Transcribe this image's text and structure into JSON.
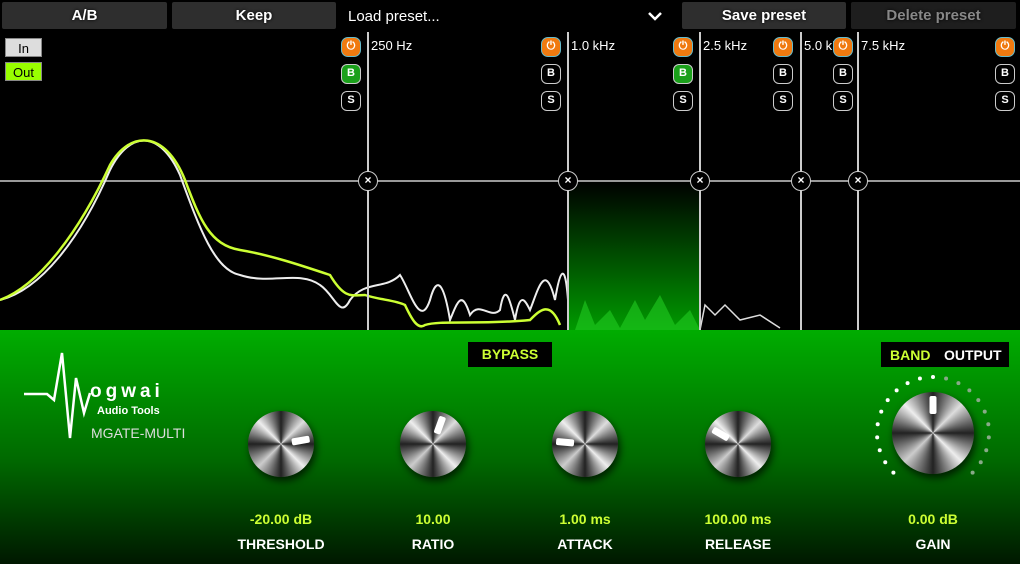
{
  "toolbar": {
    "ab": "A/B",
    "keep": "Keep",
    "load_preset": "Load preset...",
    "save_preset": "Save preset",
    "delete_preset": "Delete preset"
  },
  "io": {
    "in": "In",
    "out": "Out"
  },
  "bands": [
    {
      "freq": "250 Hz",
      "power": true,
      "b": true,
      "s": false
    },
    {
      "freq": "1.0 kHz",
      "power": true,
      "b": false,
      "s": false
    },
    {
      "freq": "2.5 kHz",
      "power": true,
      "b": true,
      "s": false
    },
    {
      "freq": "5.0 kHz",
      "power": true,
      "b": false,
      "s": false
    },
    {
      "freq": "7.5 kHz",
      "power": true,
      "b": false,
      "s": false
    },
    {
      "power": true,
      "b": false,
      "s": false
    }
  ],
  "icon_labels": {
    "b": "B",
    "s": "S",
    "x": "×",
    "power": "⏻"
  },
  "brand": {
    "logo": "ogwai",
    "sub": "Audio Tools",
    "product": "MGATE-MULTI"
  },
  "buttons": {
    "bypass": "BYPASS",
    "band": "BAND",
    "output": "OUTPUT"
  },
  "knobs": [
    {
      "label": "THRESHOLD",
      "value": "-20.00 dB",
      "angle": -10
    },
    {
      "label": "RATIO",
      "value": "10.00",
      "angle": -70
    },
    {
      "label": "ATTACK",
      "value": "1.00 ms",
      "angle": 185
    },
    {
      "label": "RELEASE",
      "value": "100.00 ms",
      "angle": 210
    },
    {
      "label": "GAIN",
      "value": "0.00 dB",
      "angle": -90
    }
  ],
  "colors": {
    "accent": "#ccff33",
    "panel": "#00ad00",
    "power": "#f07a10",
    "b_active": "#1aa01a",
    "out_active": "#99ff00"
  }
}
